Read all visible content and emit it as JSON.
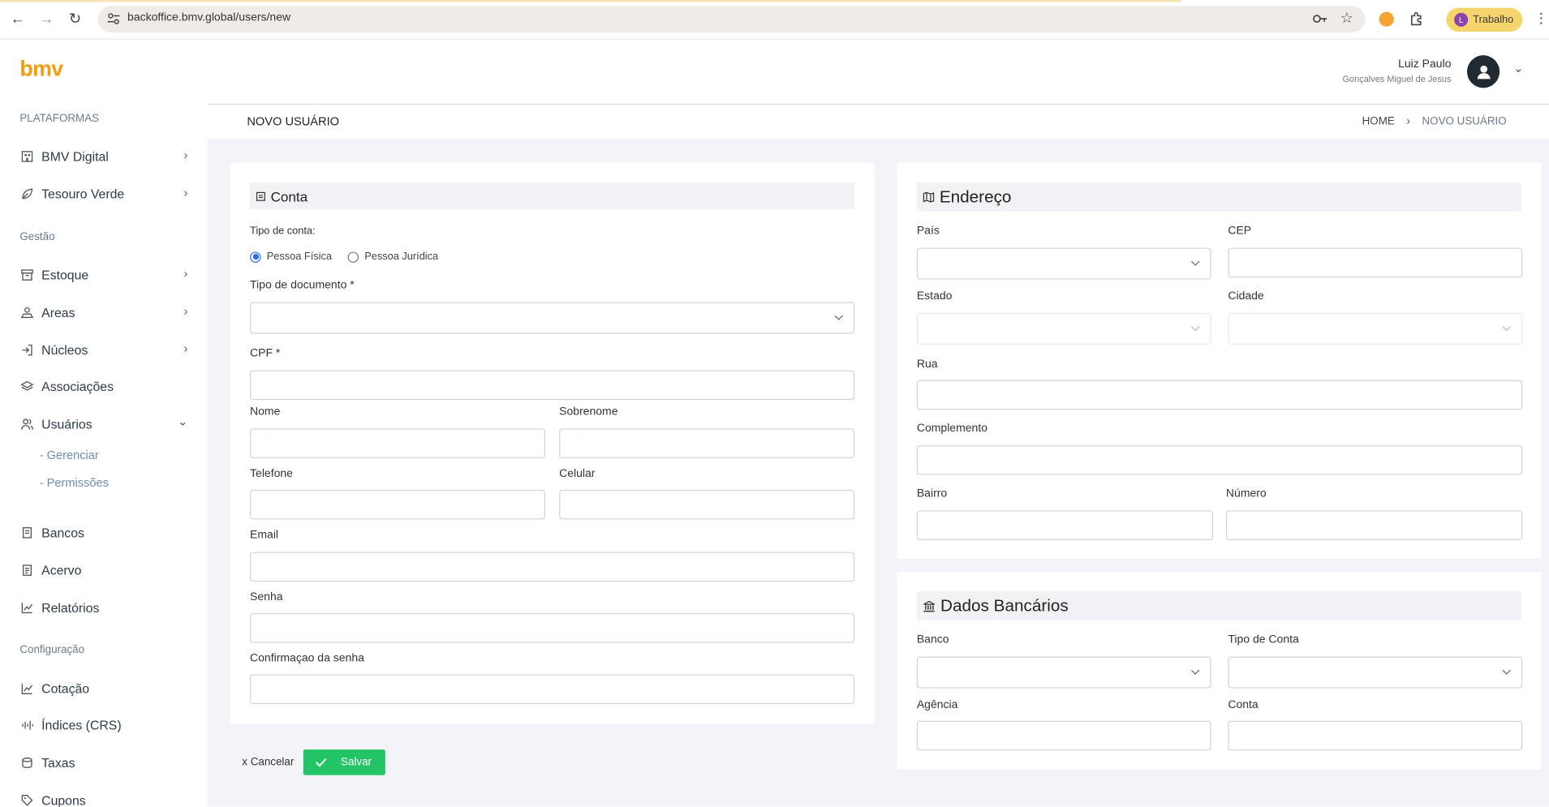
{
  "browser": {
    "url": "backoffice.bmv.global/users/new",
    "profile_initial": "L",
    "profile_label": "Trabalho"
  },
  "header": {
    "logo": "bmv",
    "user_name": "Luiz Paulo",
    "user_sub": "Gonçalves Miguel de Jesus"
  },
  "sidebar": {
    "sections": {
      "plataformas": "PLATAFORMAS",
      "gestao": "Gestão",
      "configuracao": "Configuração"
    },
    "items": {
      "bmv_digital": "BMV Digital",
      "tesouro_verde": "Tesouro Verde",
      "estoque": "Estoque",
      "areas": "Areas",
      "nucleos": "Núcleos",
      "associacoes": "Associações",
      "usuarios": "Usuários",
      "gerenciar": "- Gerenciar",
      "permissoes": "- Permissões",
      "bancos": "Bancos",
      "acervo": "Acervo",
      "relatorios": "Relatórios",
      "cotacao": "Cotação",
      "indices": "Índices (CRS)",
      "taxas": "Taxas",
      "cupons": "Cupons"
    }
  },
  "page": {
    "title": "NOVO USUÁRIO",
    "breadcrumb_home": "HOME",
    "breadcrumb_sep": "›",
    "breadcrumb_current": "NOVO USUÁRIO"
  },
  "conta": {
    "title": "Conta",
    "tipo_conta_label": "Tipo de conta:",
    "radio_fisica": "Pessoa Física",
    "radio_juridica": "Pessoa Jurídica",
    "selected_type": "Pessoa Física",
    "tipo_documento_label": "Tipo de documento *",
    "tipo_documento_value": "",
    "cpf_label": "CPF *",
    "cpf_value": "",
    "nome_label": "Nome",
    "nome_value": "",
    "sobrenome_label": "Sobrenome",
    "sobrenome_value": "",
    "telefone_label": "Telefone",
    "telefone_value": "",
    "celular_label": "Celular",
    "celular_value": "",
    "email_label": "Email",
    "email_value": "",
    "senha_label": "Senha",
    "senha_value": "",
    "confirmacao_label": "Confirmaçao da senha",
    "confirmacao_value": ""
  },
  "endereco": {
    "title": "Endereço",
    "pais_label": "País",
    "cep_label": "CEP",
    "estado_label": "Estado",
    "cidade_label": "Cidade",
    "rua_label": "Rua",
    "complemento_label": "Complemento",
    "bairro_label": "Bairro",
    "numero_label": "Número"
  },
  "bancarios": {
    "title": "Dados Bancários",
    "banco_label": "Banco",
    "tipo_conta_label": "Tipo de Conta",
    "agencia_label": "Agência",
    "conta_label": "Conta"
  },
  "actions": {
    "cancel": "x Cancelar",
    "save": "Salvar"
  },
  "colors": {
    "accent": "#f39c12",
    "save_button": "#22c466",
    "radio_selected": "#2d6cdf",
    "main_bg": "#f2f4f7"
  }
}
